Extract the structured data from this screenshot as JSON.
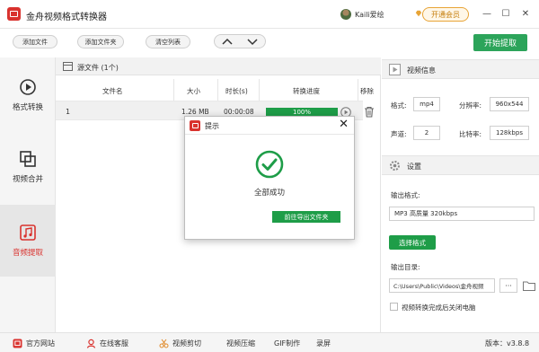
{
  "titlebar": {
    "app_title": "金舟视频格式转换器",
    "user_name": "Kaili爱绘",
    "vip_label": "开通会员",
    "minimize": "—",
    "maximize": "☐",
    "close": "✕"
  },
  "toolbar": {
    "add_file": "添加文件",
    "add_folder": "添加文件夹",
    "clear_list": "清空列表",
    "up": "⌃",
    "down": "⌄",
    "start": "开始提取"
  },
  "sidebar": {
    "items": [
      {
        "label": "格式转换",
        "icon": "play-circle-icon"
      },
      {
        "label": "视频合并",
        "icon": "merge-icon"
      },
      {
        "label": "音频提取",
        "icon": "music-note-icon"
      }
    ],
    "active": 2,
    "accent_color": "#d9322e"
  },
  "filepanel": {
    "title": "源文件 (1个)",
    "columns": [
      "文件名",
      "大小",
      "时长(s)",
      "转换进度",
      "移除"
    ],
    "rows": [
      {
        "name": "1",
        "size": "1.26 MB",
        "duration": "00:00:08",
        "progress": "100%"
      }
    ]
  },
  "rightpanel": {
    "video_info_title": "视频信息",
    "format_label": "格式:",
    "format_value": "mp4",
    "resolution_label": "分辨率:",
    "resolution_value": "960x544",
    "channel_label": "声道:",
    "channel_value": "2",
    "bitrate_label": "比特率:",
    "bitrate_value": "128kbps",
    "settings_title": "设置",
    "output_format_label": "输出格式:",
    "output_format_value": "MP3 高质量 320kbps",
    "select_format_btn": "选择格式",
    "output_dir_label": "输出目录:",
    "output_dir_value": "C:\\Users\\Public\\Videos\\金舟视频",
    "more_btn": "···",
    "shutdown_label": "视频转换完成后关闭电脑"
  },
  "bottombar": {
    "website": "官方网站",
    "support": "在线客服",
    "video_cut": "视频剪切",
    "video_compress": "视频压缩",
    "gif": "GIF制作",
    "record": "录屏",
    "version": "版本：v3.8.8"
  },
  "modal": {
    "title": "提示",
    "close": "✕",
    "message": "全部成功",
    "button": "前往导出文件夹",
    "success_color": "#1e9d48"
  }
}
